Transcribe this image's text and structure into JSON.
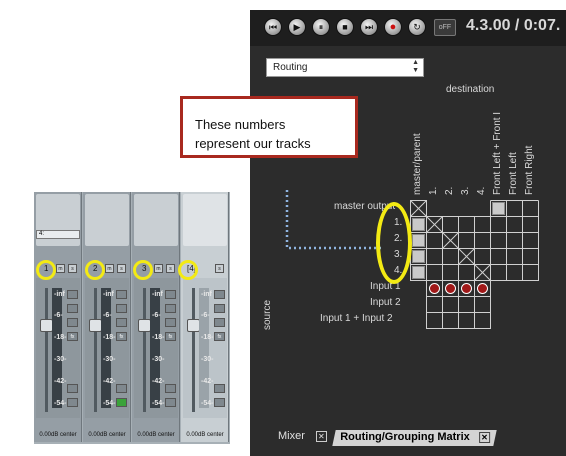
{
  "transport": {
    "buttons": [
      "rewind-to-start",
      "play",
      "pause",
      "stop",
      "skip-to-end",
      "record",
      "repeat"
    ],
    "off_label": "oFF",
    "time": "4.3.00 / 0:07."
  },
  "routing": {
    "select_value": "Routing",
    "destination_label": "destination",
    "source_label": "source",
    "destinations": [
      "master/parent",
      "1.",
      "2.",
      "3.",
      "4.",
      "Front Left + Front I",
      "Front Left",
      "Front Right"
    ],
    "master_output_label": "master output",
    "track_sources": [
      "1.",
      "2.",
      "3.",
      "4."
    ],
    "input_sources": [
      "Input 1",
      "Input 2",
      "Input 1 + Input 2"
    ]
  },
  "callout": {
    "text_line1": "These numbers",
    "text_line2": "represent our tracks"
  },
  "mixer": {
    "strips": [
      {
        "number": "1",
        "center": "0.00dB center"
      },
      {
        "number": "2",
        "center": "0.00dB center"
      },
      {
        "number": "3",
        "center": "0.00dB center"
      },
      {
        "number": "[4]",
        "center": "0.00dB center"
      }
    ],
    "db_marks": [
      "-inf",
      "-6-",
      "-18-",
      "-30-",
      "-42-",
      "-54-"
    ],
    "input_label": "4:"
  },
  "tabs": [
    {
      "label": "Mixer"
    },
    {
      "label": "Routing/Grouping Matrix"
    }
  ],
  "colors": {
    "callout_border": "#a8291f",
    "highlight": "#f3ea14",
    "connection_dot": "#a01818",
    "dotted_line": "#8fb4e0"
  }
}
